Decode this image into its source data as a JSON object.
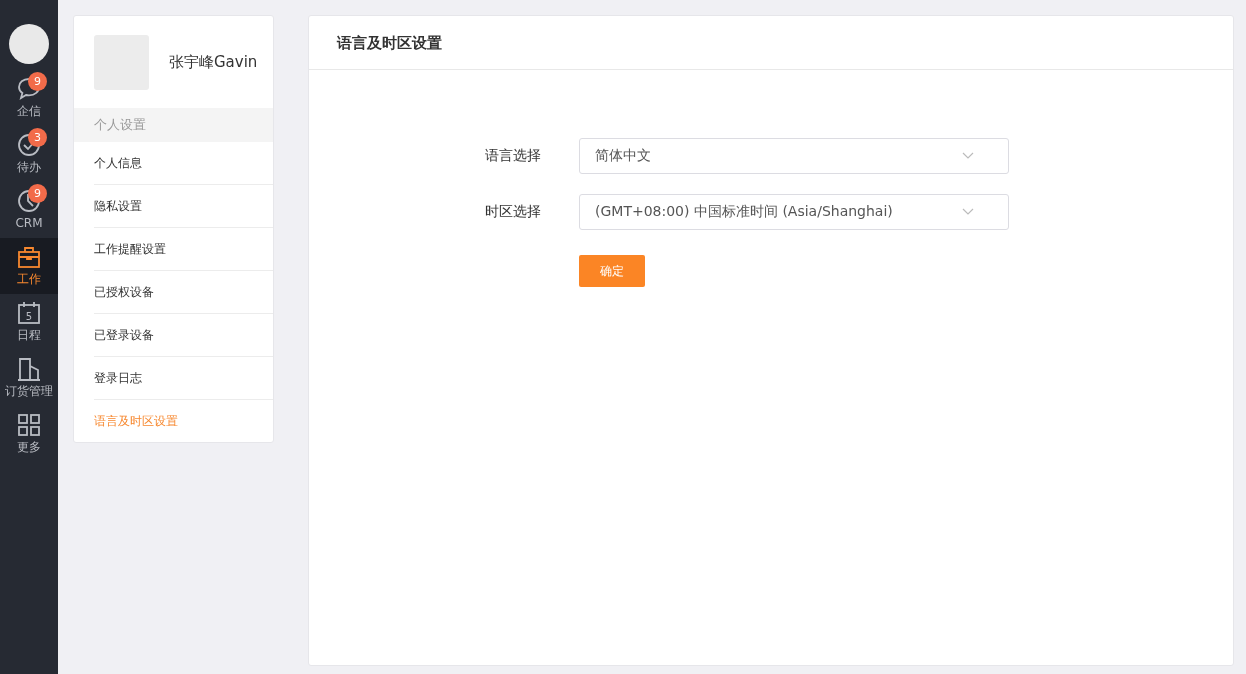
{
  "nav": [
    {
      "label": "企信",
      "badge": "9",
      "selected": false
    },
    {
      "label": "待办",
      "badge": "3",
      "selected": false
    },
    {
      "label": "CRM",
      "badge": "9",
      "selected": false
    },
    {
      "label": "工作",
      "selected": true
    },
    {
      "label": "日程",
      "icon_text": "5",
      "selected": false
    },
    {
      "label": "订货管理",
      "selected": false
    },
    {
      "label": "更多",
      "selected": false
    }
  ],
  "profile": {
    "name": "张宇峰Gavin"
  },
  "settings_menu": {
    "section": "个人设置",
    "items": [
      {
        "label": "个人信息",
        "selected": false
      },
      {
        "label": "隐私设置",
        "selected": false
      },
      {
        "label": "工作提醒设置",
        "selected": false
      },
      {
        "label": "已授权设备",
        "selected": false
      },
      {
        "label": "已登录设备",
        "selected": false
      },
      {
        "label": "登录日志",
        "selected": false
      },
      {
        "label": "语言及时区设置",
        "selected": true
      }
    ]
  },
  "panel": {
    "title": "语言及时区设置",
    "fields": [
      {
        "label": "语言选择",
        "value": "简体中文"
      },
      {
        "label": "时区选择",
        "value": "(GMT+08:00) 中国标准时间 (Asia/Shanghai)"
      }
    ],
    "submit": "确定"
  }
}
